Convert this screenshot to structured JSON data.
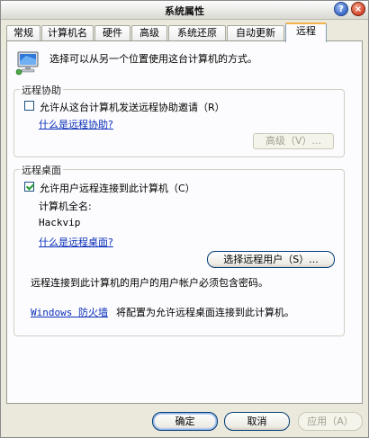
{
  "window": {
    "title": "系统属性",
    "help_glyph": "?",
    "close_glyph": "×"
  },
  "tabs": [
    {
      "label": "常规"
    },
    {
      "label": "计算机名"
    },
    {
      "label": "硬件"
    },
    {
      "label": "高级"
    },
    {
      "label": "系统还原"
    },
    {
      "label": "自动更新"
    },
    {
      "label": "远程",
      "active": true
    }
  ],
  "intro": {
    "text": "选择可以从另一个位置使用这台计算机的方式。",
    "icon": "computer-network-icon"
  },
  "remote_assistance": {
    "legend": "远程协助",
    "checkbox_label": "允许从这台计算机发送远程协助邀请（R）",
    "checked": false,
    "link": "什么是远程协助?",
    "advanced_button": "高级（V）..."
  },
  "remote_desktop": {
    "legend": "远程桌面",
    "checkbox_label": "允许用户远程连接到此计算机（C）",
    "checked": true,
    "full_name_label": "计算机全名:",
    "computer_name": "Hackvip",
    "link": "什么是远程桌面?",
    "select_users_button": "选择远程用户（S）...",
    "password_note": "远程连接到此计算机的用户的用户帐户必须包含密码。",
    "firewall_link": "Windows 防火墙",
    "firewall_note": "将配置为允许远程桌面连接到此计算机。"
  },
  "footer": {
    "ok": "确定",
    "cancel": "取消",
    "apply": "应用（A）"
  },
  "colors": {
    "link": "#0b2fb8",
    "tab_highlight": "#f4b24b",
    "panel": "#fcfcfe",
    "dialog": "#ebe9dc"
  }
}
